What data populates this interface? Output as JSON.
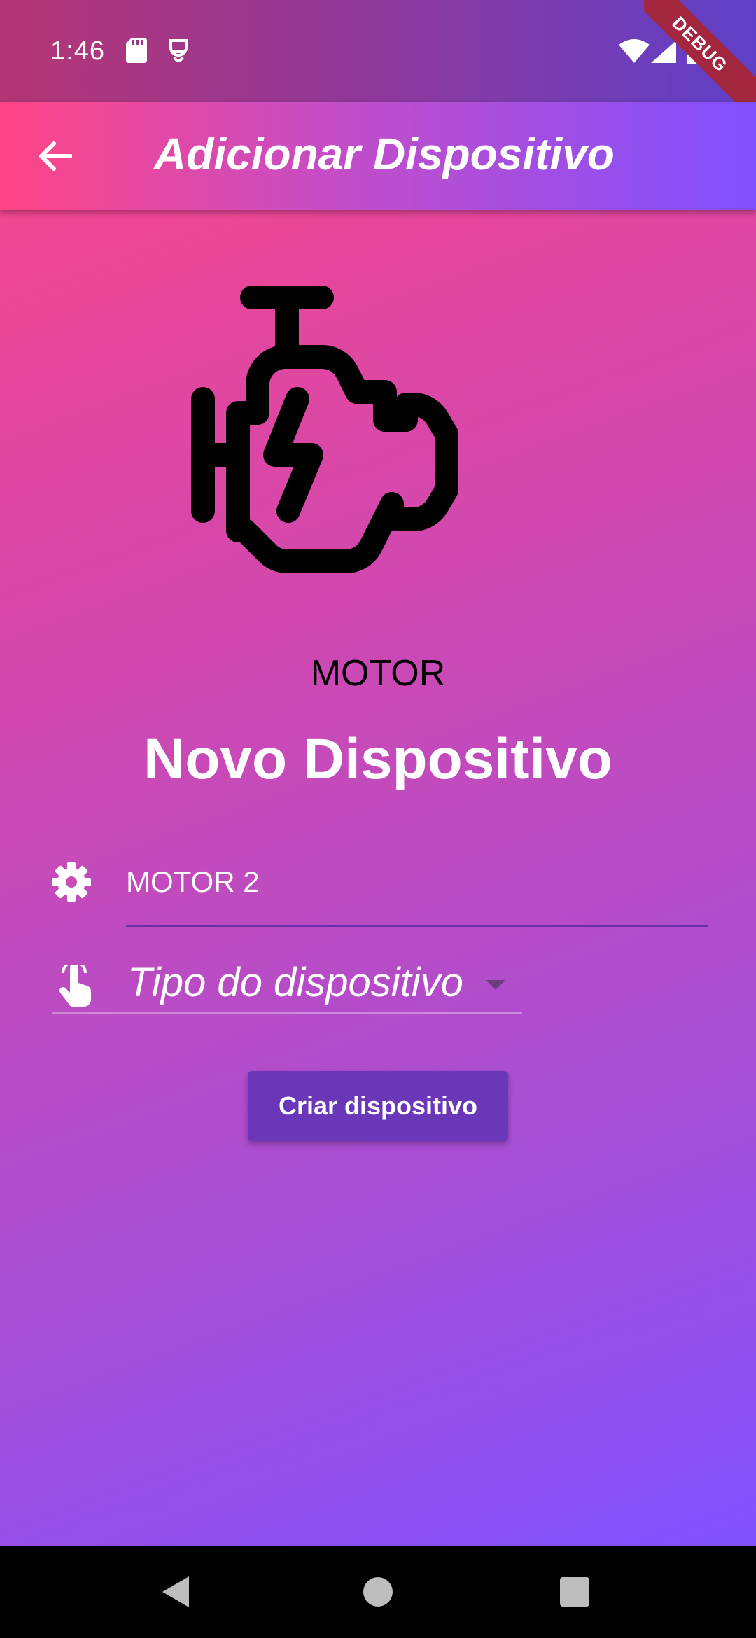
{
  "status_bar": {
    "time": "1:46",
    "debug_label": "DEBUG"
  },
  "app_bar": {
    "title": "Adicionar Dispositivo",
    "back_icon": "arrow-back-icon"
  },
  "device": {
    "icon": "engine-icon",
    "type_label": "MOTOR"
  },
  "form": {
    "heading": "Novo Dispositivo",
    "name_value": "MOTOR 2",
    "type_placeholder": "Tipo do dispositivo",
    "submit_label": "Criar dispositivo"
  },
  "colors": {
    "gradient_top": "#ff4584",
    "gradient_bottom": "#7f50ff",
    "button": "#6a37b9"
  }
}
